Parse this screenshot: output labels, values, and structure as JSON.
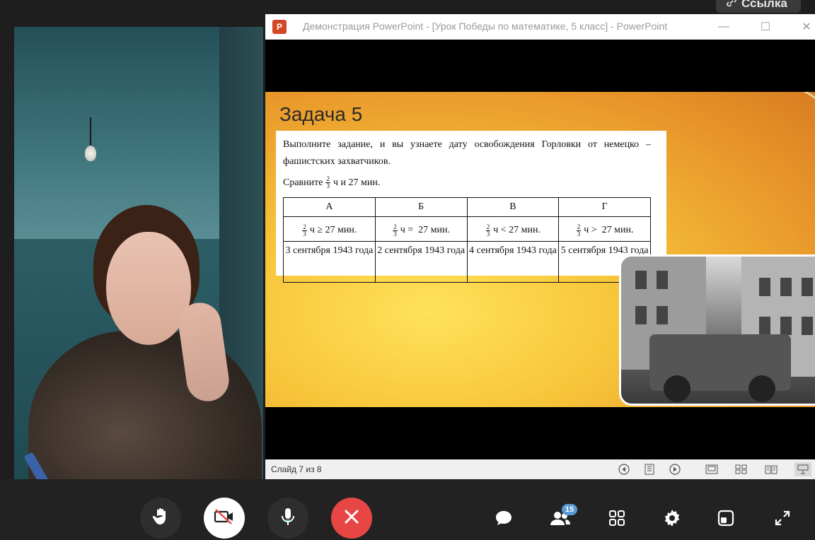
{
  "top_link": {
    "label": "Ссылка",
    "icon": "link-icon"
  },
  "powerpoint": {
    "window_title": "Демонстрация PowerPoint - [Урок Победы по математике, 5 класс] - PowerPoint",
    "logo_letter": "P",
    "controls": {
      "minimize": "—",
      "maximize": "☐",
      "close": "✕"
    },
    "slide": {
      "title": "Задача 5",
      "task_text": "Выполните задание, и вы узнаете дату освобождения Горловки от немецко – фашистских захватчиков.",
      "compare_prefix": "Сравните",
      "fraction": {
        "num": "2",
        "den": "3"
      },
      "compare_suffix": "ч и 27 мин.",
      "table": {
        "headers": [
          "А",
          "Б",
          "В",
          "Г"
        ],
        "expressions": [
          {
            "num": "2",
            "den": "3",
            "text": "ч ≥ 27 мин."
          },
          {
            "num": "2",
            "den": "3",
            "text": "ч =  27 мин."
          },
          {
            "num": "2",
            "den": "3",
            "text": "ч < 27 мин."
          },
          {
            "num": "2",
            "den": "3",
            "text": "ч >  27 мин."
          }
        ],
        "dates": [
          "3 сентября 1943 года",
          "2 сентября 1943 года",
          "4 сентября 1943 года",
          "5 сентября 1943 года"
        ]
      }
    },
    "status": {
      "slide_counter": "Слайд 7 из 8"
    }
  },
  "call_toolbar": {
    "participants_count": "15",
    "colors": {
      "camera_btn": "#ffffff",
      "end_call": "#e84545",
      "dark_btn": "#2e2e2e"
    }
  }
}
